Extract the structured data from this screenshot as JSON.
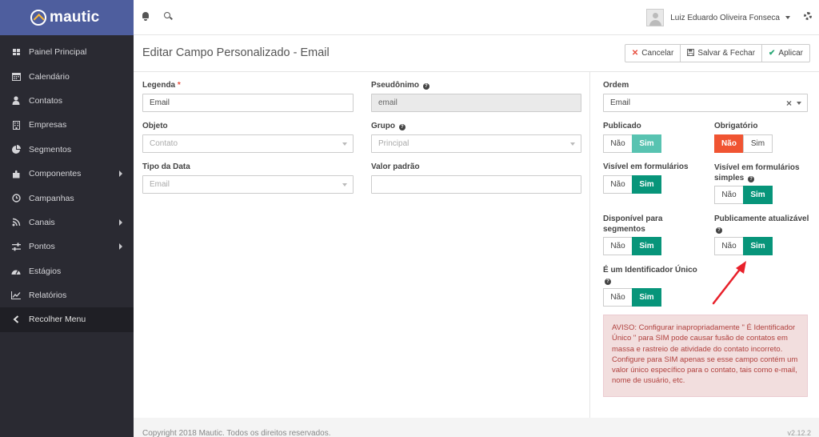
{
  "brand": {
    "name": "mautic"
  },
  "sidebar": {
    "items": [
      {
        "label": "Painel Principal",
        "icon": "dashboard-icon",
        "has_arrow": false
      },
      {
        "label": "Calendário",
        "icon": "calendar-icon",
        "has_arrow": false
      },
      {
        "label": "Contatos",
        "icon": "user-icon",
        "has_arrow": false
      },
      {
        "label": "Empresas",
        "icon": "building-icon",
        "has_arrow": false
      },
      {
        "label": "Segmentos",
        "icon": "pie-chart-icon",
        "has_arrow": false
      },
      {
        "label": "Componentes",
        "icon": "puzzle-icon",
        "has_arrow": true
      },
      {
        "label": "Campanhas",
        "icon": "clock-icon",
        "has_arrow": false
      },
      {
        "label": "Canais",
        "icon": "rss-icon",
        "has_arrow": true
      },
      {
        "label": "Pontos",
        "icon": "sliders-icon",
        "has_arrow": true
      },
      {
        "label": "Estágios",
        "icon": "tachometer-icon",
        "has_arrow": false
      },
      {
        "label": "Relatórios",
        "icon": "line-chart-icon",
        "has_arrow": false
      },
      {
        "label": "Recolher Menu",
        "icon": "chevron-left-icon",
        "has_arrow": false
      }
    ]
  },
  "topbar": {
    "user_name": "Luiz Eduardo Oliveira Fonseca"
  },
  "header": {
    "title": "Editar Campo Personalizado - Email",
    "buttons": {
      "cancel": "Cancelar",
      "save_close": "Salvar & Fechar",
      "apply": "Aplicar"
    }
  },
  "form": {
    "legenda": {
      "label": "Legenda",
      "required_mark": "*",
      "value": "Email"
    },
    "pseudonimo": {
      "label": "Pseudônimo",
      "value": "email"
    },
    "objeto": {
      "label": "Objeto",
      "value": "Contato"
    },
    "grupo": {
      "label": "Grupo",
      "value": "Principal"
    },
    "tipo_data": {
      "label": "Tipo da Data",
      "value": "Email"
    },
    "valor_padrao": {
      "label": "Valor padrão",
      "value": ""
    }
  },
  "options": {
    "ordem": {
      "label": "Ordem",
      "value": "Email"
    },
    "no_label": "Não",
    "yes_label": "Sim",
    "publicado": {
      "label": "Publicado",
      "value": "Sim"
    },
    "obrigatorio": {
      "label": "Obrigatório",
      "value": "Não"
    },
    "visivel_formularios": {
      "label": "Visível em formulários",
      "value": "Sim"
    },
    "visivel_formularios_simples": {
      "label": "Visível em formulários simples",
      "value": "Sim"
    },
    "disponivel_segmentos": {
      "label": "Disponível para segmentos",
      "value": "Sim"
    },
    "publicamente_atualizavel": {
      "label": "Publicamente atualizável",
      "value": "Sim"
    },
    "identificador_unico": {
      "label": "É um Identificador Único",
      "value": "Sim"
    },
    "warning": "AVISO: Configurar inapropriadamente \" É Identificador Único \" para SIM pode causar fusão de contatos em massa e rastreio de atividade do contato incorreto. Configure para SIM apenas se esse campo contém um valor único específico para o contato, tais como e-mail, nome de usuário, etc."
  },
  "footer": {
    "copyright": "Copyright 2018 Mautic. Todos os direitos reservados.",
    "version": "v2.12.2"
  },
  "colors": {
    "brand": "#4e5e9e",
    "sidebar": "#2a2a32",
    "toggle_on": "#07957a",
    "toggle_on_light": "#58c3b1",
    "toggle_danger": "#f05432",
    "annotation_arrow": "#e8202a"
  }
}
